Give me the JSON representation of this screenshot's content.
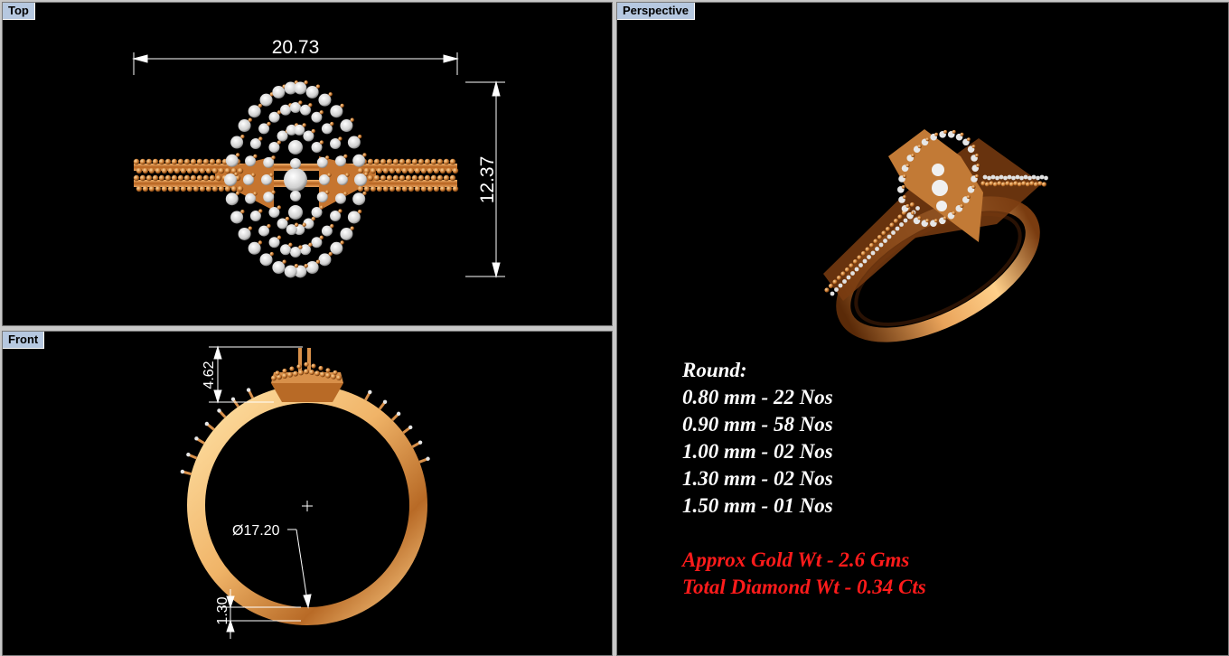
{
  "viewports": {
    "top": {
      "label": "Top"
    },
    "front": {
      "label": "Front"
    },
    "perspective": {
      "label": "Perspective"
    }
  },
  "dimensions": {
    "width": "20.73",
    "height": "12.37",
    "head_height": "4.62",
    "inner_diameter": "Ø17.20",
    "band_thickness": "1.30"
  },
  "specs": {
    "heading": "Round:",
    "sizes": [
      "0.80 mm - 22 Nos",
      "0.90 mm - 58 Nos",
      "1.00 mm - 02 Nos",
      "1.30 mm - 02 Nos",
      "1.50 mm - 01 Nos"
    ],
    "gold_weight": "Approx Gold Wt - 2.6 Gms",
    "diamond_weight": "Total Diamond Wt - 0.34 Cts"
  },
  "colors": {
    "viewport_bg": "#000000",
    "tab_bg": "#b6c8e0",
    "gold": "#d9904a",
    "gold_light": "#ffd48a",
    "diamond": "#e8e8e8",
    "spec_text": "#ffffff",
    "spec_highlight": "#ff1b1b"
  }
}
